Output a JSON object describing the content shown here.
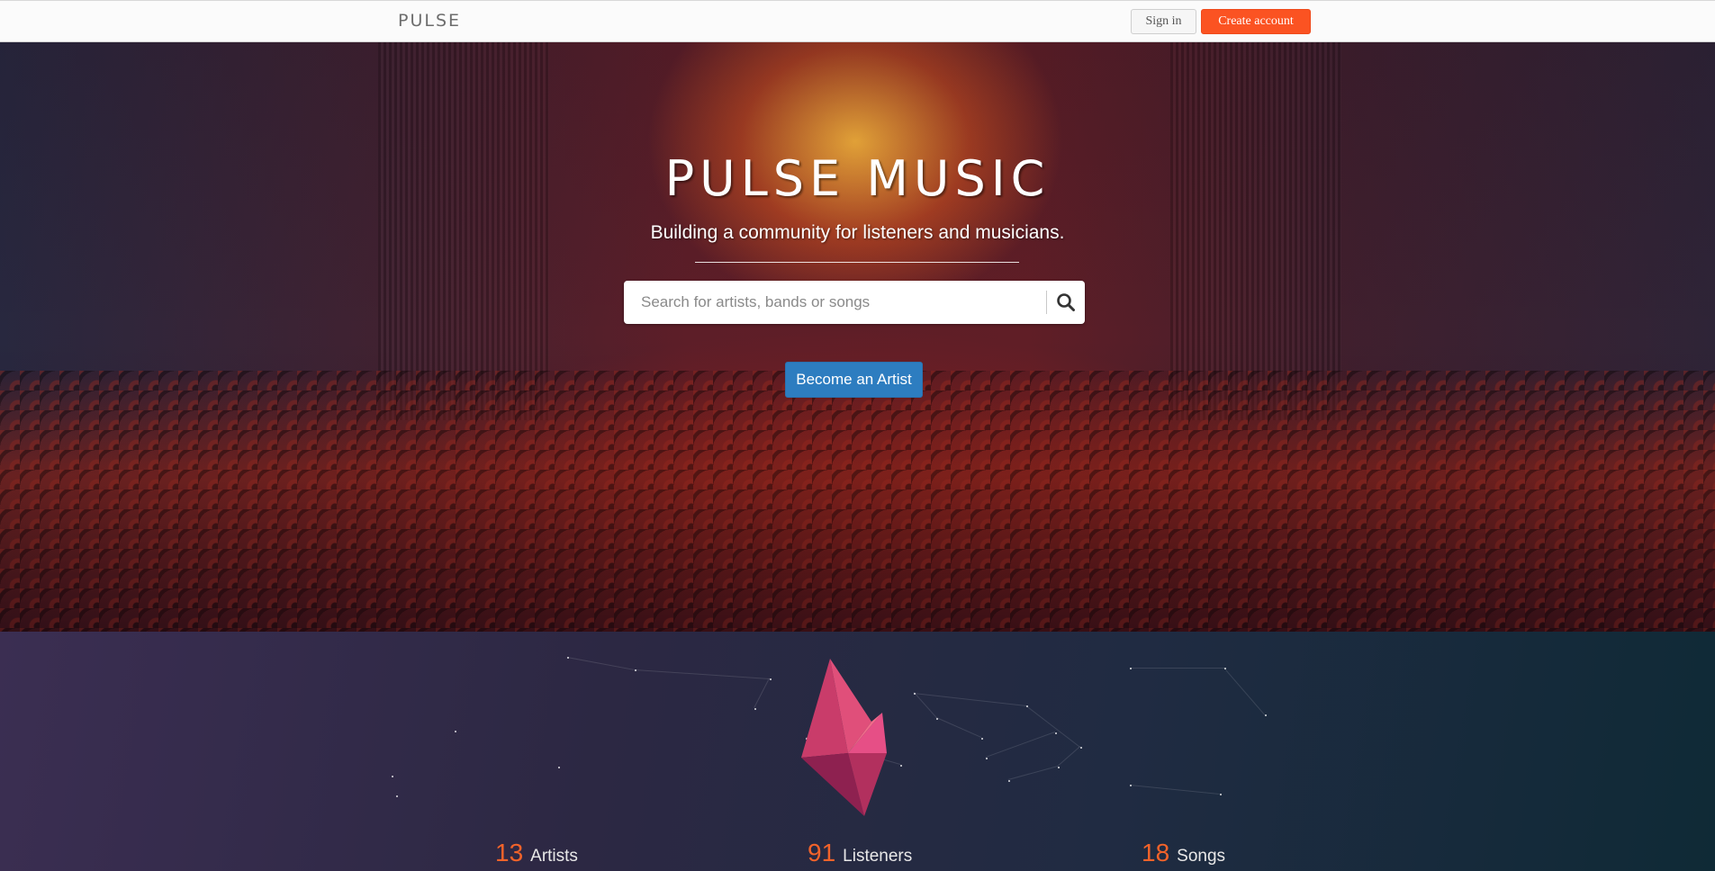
{
  "header": {
    "brand": "PULSE",
    "signin_label": "Sign in",
    "create_account_label": "Create account"
  },
  "hero": {
    "title": "PULSE MUSIC",
    "subtitle": "Building a community for listeners and musicians.",
    "search": {
      "placeholder": "Search for artists, bands or songs",
      "value": ""
    },
    "search_icon": "search-icon",
    "cta_label": "Become an Artist"
  },
  "stats": [
    {
      "value": "13",
      "label": "Artists"
    },
    {
      "value": "91",
      "label": "Listeners"
    },
    {
      "value": "18",
      "label": "Songs"
    }
  ],
  "colors": {
    "accent": "#fb5322",
    "primary_button": "#2d7dc0",
    "stat_number": "#f2632a"
  }
}
